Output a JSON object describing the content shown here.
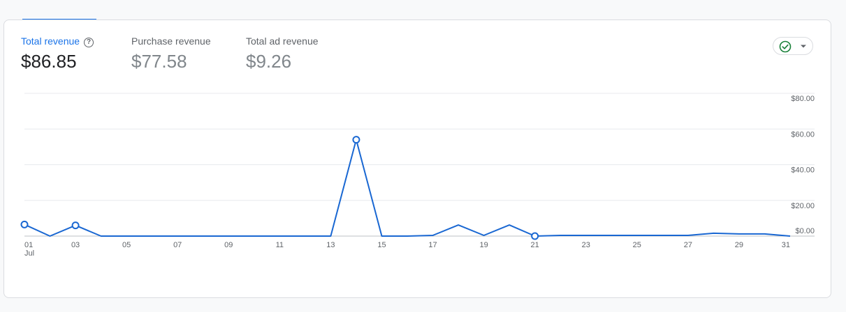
{
  "metrics": [
    {
      "label": "Total revenue",
      "value": "$86.85",
      "active": true
    },
    {
      "label": "Purchase revenue",
      "value": "$77.58",
      "active": false
    },
    {
      "label": "Total ad revenue",
      "value": "$9.26",
      "active": false
    }
  ],
  "help_icon_glyph": "?",
  "status_icon": "check-circle-icon",
  "colors": {
    "accent": "#1a73e8",
    "line": "#1967d2",
    "grid": "#e8eaed",
    "status_green": "#188038"
  },
  "chart_data": {
    "type": "line",
    "x": [
      1,
      2,
      3,
      4,
      5,
      6,
      7,
      8,
      9,
      10,
      11,
      12,
      13,
      14,
      15,
      16,
      17,
      18,
      19,
      20,
      21,
      22,
      23,
      24,
      25,
      26,
      27,
      28,
      29,
      30,
      31
    ],
    "series": [
      {
        "values": [
          6.5,
          0,
          6,
          0,
          0,
          0,
          0,
          0,
          0,
          0,
          0,
          0,
          0,
          54,
          0,
          0,
          0.4,
          6.2,
          0.4,
          6.2,
          0,
          0.4,
          0.4,
          0.4,
          0.4,
          0.4,
          0.4,
          1.6,
          1.2,
          1.2,
          0
        ]
      }
    ],
    "markers": [
      1,
      3,
      14,
      21
    ],
    "x_tick_labels": [
      "01",
      "03",
      "05",
      "07",
      "09",
      "11",
      "13",
      "15",
      "17",
      "19",
      "21",
      "23",
      "25",
      "27",
      "29",
      "31"
    ],
    "x_tick_days": [
      1,
      3,
      5,
      7,
      9,
      11,
      13,
      15,
      17,
      19,
      21,
      23,
      25,
      27,
      29,
      31
    ],
    "x_month_label": "Jul",
    "y_ticks": [
      0,
      20,
      40,
      60,
      80
    ],
    "y_tick_labels": [
      "$0.00",
      "$20.00",
      "$40.00",
      "$60.00",
      "$80.00"
    ],
    "ylim": [
      0,
      80
    ],
    "grid": true,
    "axis_side": "right"
  }
}
